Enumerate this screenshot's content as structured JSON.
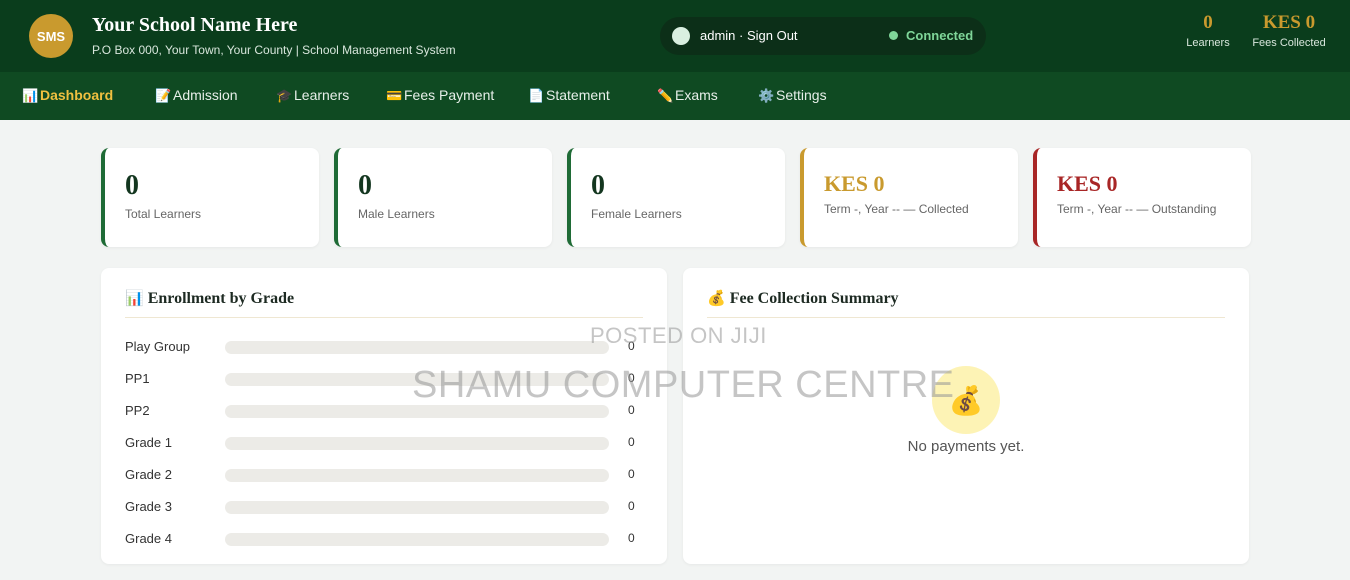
{
  "header": {
    "logo_text": "SMS",
    "school_name": "Your School Name Here",
    "subtitle": "P.O Box 000, Your Town, Your County | School Management System",
    "session_text": "admin · Sign Out",
    "status": "Connected",
    "status_color": "#7fd699",
    "stats": [
      {
        "value": "0",
        "label": "Learners"
      },
      {
        "value": "KES 0",
        "label": "Fees Collected"
      }
    ]
  },
  "nav": [
    {
      "icon": "📊",
      "icon_name": "bar-chart-icon",
      "label": "Dashboard",
      "active": true
    },
    {
      "icon": "📝",
      "icon_name": "memo-icon",
      "label": "Admission"
    },
    {
      "icon": "🎓",
      "icon_name": "graduation-cap-icon",
      "label": "Learners"
    },
    {
      "icon": "💳",
      "icon_name": "credit-card-icon",
      "label": "Fees Payment"
    },
    {
      "icon": "📄",
      "icon_name": "document-icon",
      "label": "Statement"
    },
    {
      "icon": "✏️",
      "icon_name": "pencil-icon",
      "label": "Exams"
    },
    {
      "icon": "⚙️",
      "icon_name": "gear-icon",
      "label": "Settings"
    }
  ],
  "stat_cards": [
    {
      "value": "0",
      "label": "Total Learners"
    },
    {
      "value": "0",
      "label": "Male Learners"
    },
    {
      "value": "0",
      "label": "Female Learners"
    },
    {
      "value": "KES 0",
      "label": "Term -, Year -- — Collected"
    },
    {
      "value": "KES 0",
      "label": "Term -, Year -- — Outstanding"
    }
  ],
  "enrollment": {
    "icon": "📊",
    "title": "Enrollment by Grade",
    "rows": [
      {
        "grade": "Play Group",
        "count": "0",
        "fill_fraction": 0
      },
      {
        "grade": "PP1",
        "count": "0",
        "fill_fraction": 0
      },
      {
        "grade": "PP2",
        "count": "0",
        "fill_fraction": 0
      },
      {
        "grade": "Grade 1",
        "count": "0",
        "fill_fraction": 0
      },
      {
        "grade": "Grade 2",
        "count": "0",
        "fill_fraction": 0
      },
      {
        "grade": "Grade 3",
        "count": "0",
        "fill_fraction": 0
      },
      {
        "grade": "Grade 4",
        "count": "0",
        "fill_fraction": 0
      }
    ]
  },
  "fees": {
    "icon": "💰",
    "title": "Fee Collection Summary",
    "empty_icon": "💰",
    "empty_text": "No payments yet."
  },
  "watermark": {
    "line1": "POSTED ON JIJI",
    "line2": "SHAMU COMPUTER CENTRE"
  },
  "colors": {
    "header_bg": "#0a3d1c",
    "nav_bg": "#0f4a22",
    "accent_gold": "#c99a2e",
    "accent_red": "#a82626",
    "accent_green": "#1f6b36"
  }
}
